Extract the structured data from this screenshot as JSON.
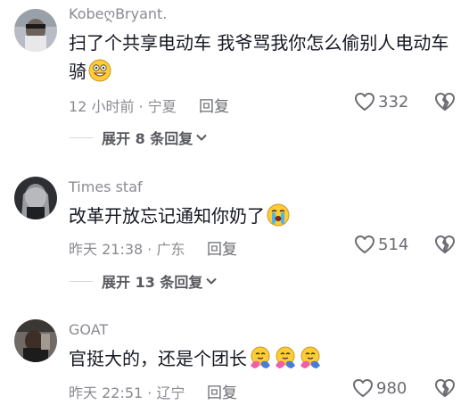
{
  "comments": [
    {
      "username": "KobeღBryant.",
      "text": "扫了个共享电动车 我爷骂我你怎么偷别人电动车骑",
      "emojis": [
        "grinning-emoji"
      ],
      "time_location": "12 小时前 · 宁夏",
      "reply_label": "回复",
      "likes": "332",
      "expand_label": "展开 8 条回复"
    },
    {
      "username": "Times staf",
      "text": "改革开放忘记通知你奶了",
      "emojis": [
        "crying-emoji"
      ],
      "time_location": "昨天 21:38 · 广东",
      "reply_label": "回复",
      "likes": "514",
      "expand_label": "展开 13 条回复"
    },
    {
      "username": "GOAT",
      "text": "官挺大的，还是个团长",
      "emojis": [
        "hug-emoji",
        "hug-emoji",
        "hug-emoji"
      ],
      "time_location": "昨天 22:51 · 辽宁",
      "reply_label": "回复",
      "likes": "980"
    }
  ],
  "colors": {
    "text": "#161823",
    "secondary": "#8a8b91",
    "action": "#6b6c72"
  }
}
